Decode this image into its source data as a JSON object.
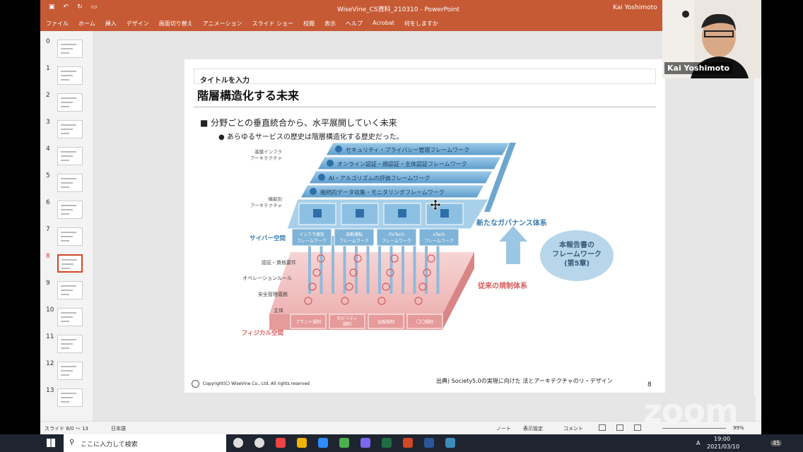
{
  "window": {
    "title": "WiseVine_CS資料_210310 - PowerPoint",
    "user": "Kai Yoshimoto"
  },
  "ribbon": {
    "tabs": [
      "ファイル",
      "ホーム",
      "挿入",
      "デザイン",
      "画面切り替え",
      "アニメーション",
      "スライド ショー",
      "校閲",
      "表示",
      "ヘルプ",
      "Acrobat",
      "何をしますか"
    ]
  },
  "thumbnails": [
    "0",
    "1",
    "2",
    "3",
    "4",
    "5",
    "6",
    "7",
    "8",
    "9",
    "10",
    "11",
    "12",
    "13"
  ],
  "active_thumbnail": "8",
  "slide": {
    "title_placeholder": "タイトルを入力",
    "heading": "階層構造化する未来",
    "bullet1": "■ 分野ごとの垂直統合から、水平展開していく未来",
    "bullet2": "● あらゆるサービスの歴史は階層構造化する歴史だった。",
    "copyright": "Copyright(C) WiseVine Co., Ltd. All rights reserved",
    "source": "出典) Society5.0の実現に向けた 法とアーキテクチャのリ・デザイン",
    "page_number": "8",
    "diagram": {
      "layer_labels": {
        "base": "基盤インフラ\nアーキテクチャ",
        "function": "機能別\nアーキテクチャ",
        "cyber": "サイバー空間",
        "auth": "認証・資格要件",
        "ops": "オペレーションルール",
        "safety": "安全管理義務",
        "subject": "主体",
        "physical": "フィジカル空間"
      },
      "frameworks": [
        "セキュリティ・プライバシー管理フレームワーク",
        "オンライン認証・顔認証・主体認証フレームワーク",
        "AI・アルゴリズムの評価フレームワーク",
        "継続的データ収集・モニタリングフレームワーク"
      ],
      "cyber_cells": [
        "インフラ保安\nフレームワーク",
        "自動運転\nフレームワーク",
        "FinTech\nフレームワーク",
        "xTech\nフレームワーク"
      ],
      "physical_cells": [
        "プラント規制",
        "モビリティ\n規制",
        "金融規制",
        "〇〇規制"
      ],
      "new_governance": "新たなガバナンス体系",
      "old_regulation": "従来の規制体系",
      "report_badge": "本報告書の\nフレームワーク\n(第5章)"
    }
  },
  "statusbar": {
    "slide_info": "スライド 8/0 〜 13",
    "language": "日本語",
    "notes": "ノート",
    "display_settings": "表示設定",
    "comments": "コメント",
    "zoom": "99%"
  },
  "taskbar": {
    "search_placeholder": "ここに入力して検索",
    "time": "19:00",
    "date": "2021/03/10",
    "ime": "A",
    "notifications": "45"
  },
  "zoom_watermark": "zoom",
  "colors": {
    "ppt_accent": "#c55a35",
    "cyber_blue": "#7fb4d8",
    "physical_red": "#e8a4a4"
  }
}
